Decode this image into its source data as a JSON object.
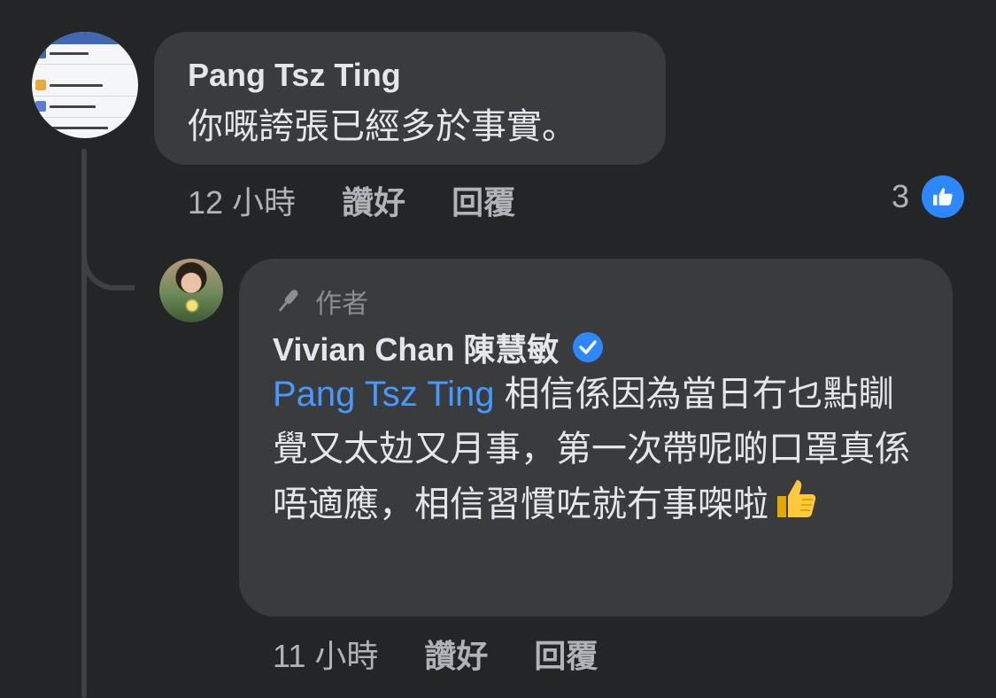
{
  "comments": [
    {
      "author": "Pang Tsz Ting",
      "text": "你嘅誇張已經多於事實。",
      "time": "12 小時",
      "like_label": "讚好",
      "reply_label": "回覆",
      "reaction_count": "3"
    }
  ],
  "reply": {
    "badge": "作者",
    "author": "Vivian Chan 陳慧敏",
    "mention": "Pang Tsz Ting",
    "text": "相信係因為當日冇乜點瞓覺又太攰又月事，第一次帶呢啲口罩真係唔適應，相信習慣咗就冇事㗎啦",
    "time": "11 小時",
    "like_label": "讚好",
    "reply_label": "回覆"
  },
  "avatar_screenshot_text": [
    "私隱設定捷徑",
    "誰可以看到我的東西？",
    "誰可以與我聯絡？",
    "我該如何防止某人騷擾我？"
  ],
  "colors": {
    "background": "#242526",
    "bubble": "#3a3b3c",
    "mention": "#4599ff",
    "like_blue": "#2d88ff"
  },
  "icons": {
    "badge": "microphone-icon",
    "verified": "verified-check-icon",
    "reaction": "like-reaction-icon",
    "emoji": "thumbs-up-emoji"
  }
}
